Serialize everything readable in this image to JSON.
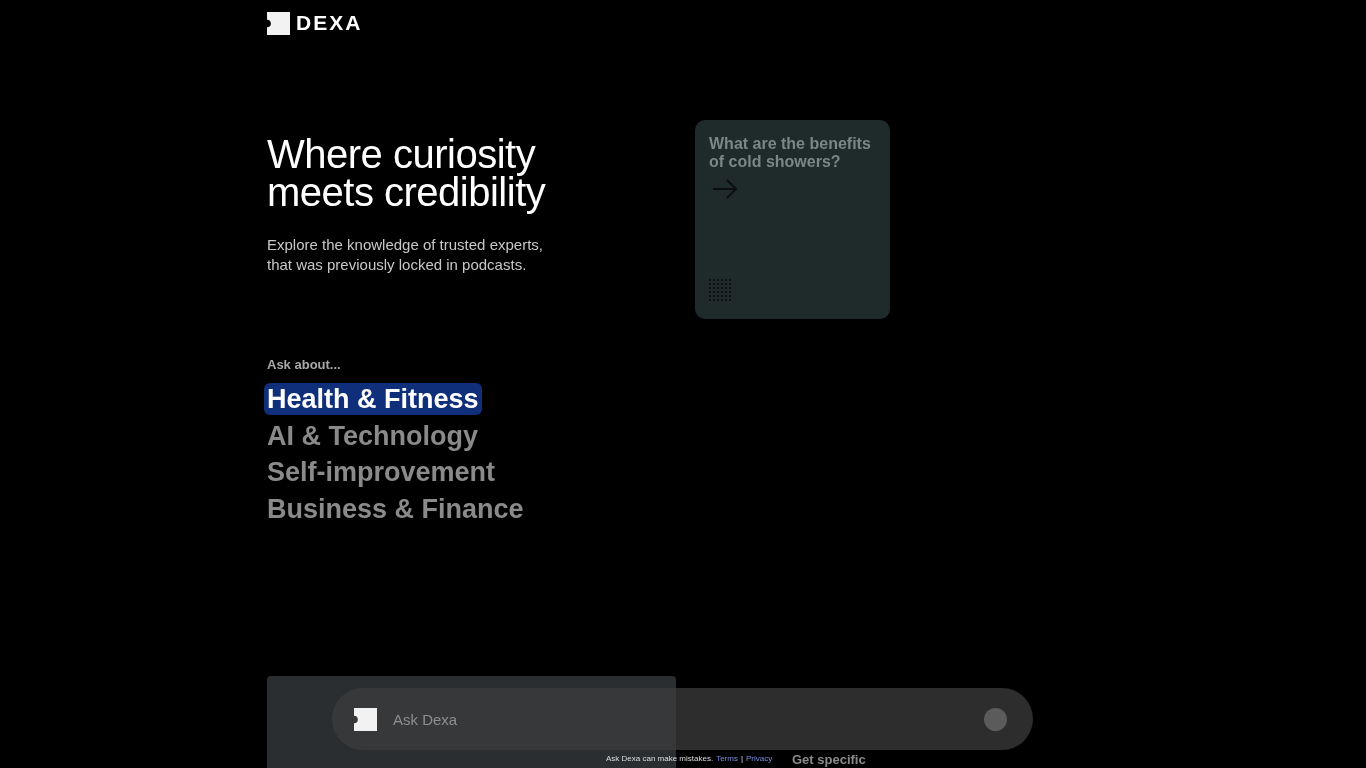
{
  "brand": {
    "name": "DEXA"
  },
  "hero": {
    "title": "Where curiosity meets credibility",
    "subtitle": "Explore the knowledge of trusted experts, that was previously locked in podcasts."
  },
  "question_card": {
    "question": "What are the benefits of cold showers?"
  },
  "topics": {
    "label": "Ask about...",
    "items": [
      {
        "label": "Health & Fitness",
        "selected": true
      },
      {
        "label": "AI & Technology",
        "selected": false
      },
      {
        "label": "Self-improvement",
        "selected": false
      },
      {
        "label": "Business & Finance",
        "selected": false
      }
    ]
  },
  "search": {
    "placeholder": "Ask Dexa"
  },
  "disclaimer": {
    "text": "Ask Dexa can make mistakes.",
    "links": [
      "Terms",
      "Privacy"
    ],
    "separator": "|"
  },
  "next_section": {
    "title": "Get specific"
  }
}
